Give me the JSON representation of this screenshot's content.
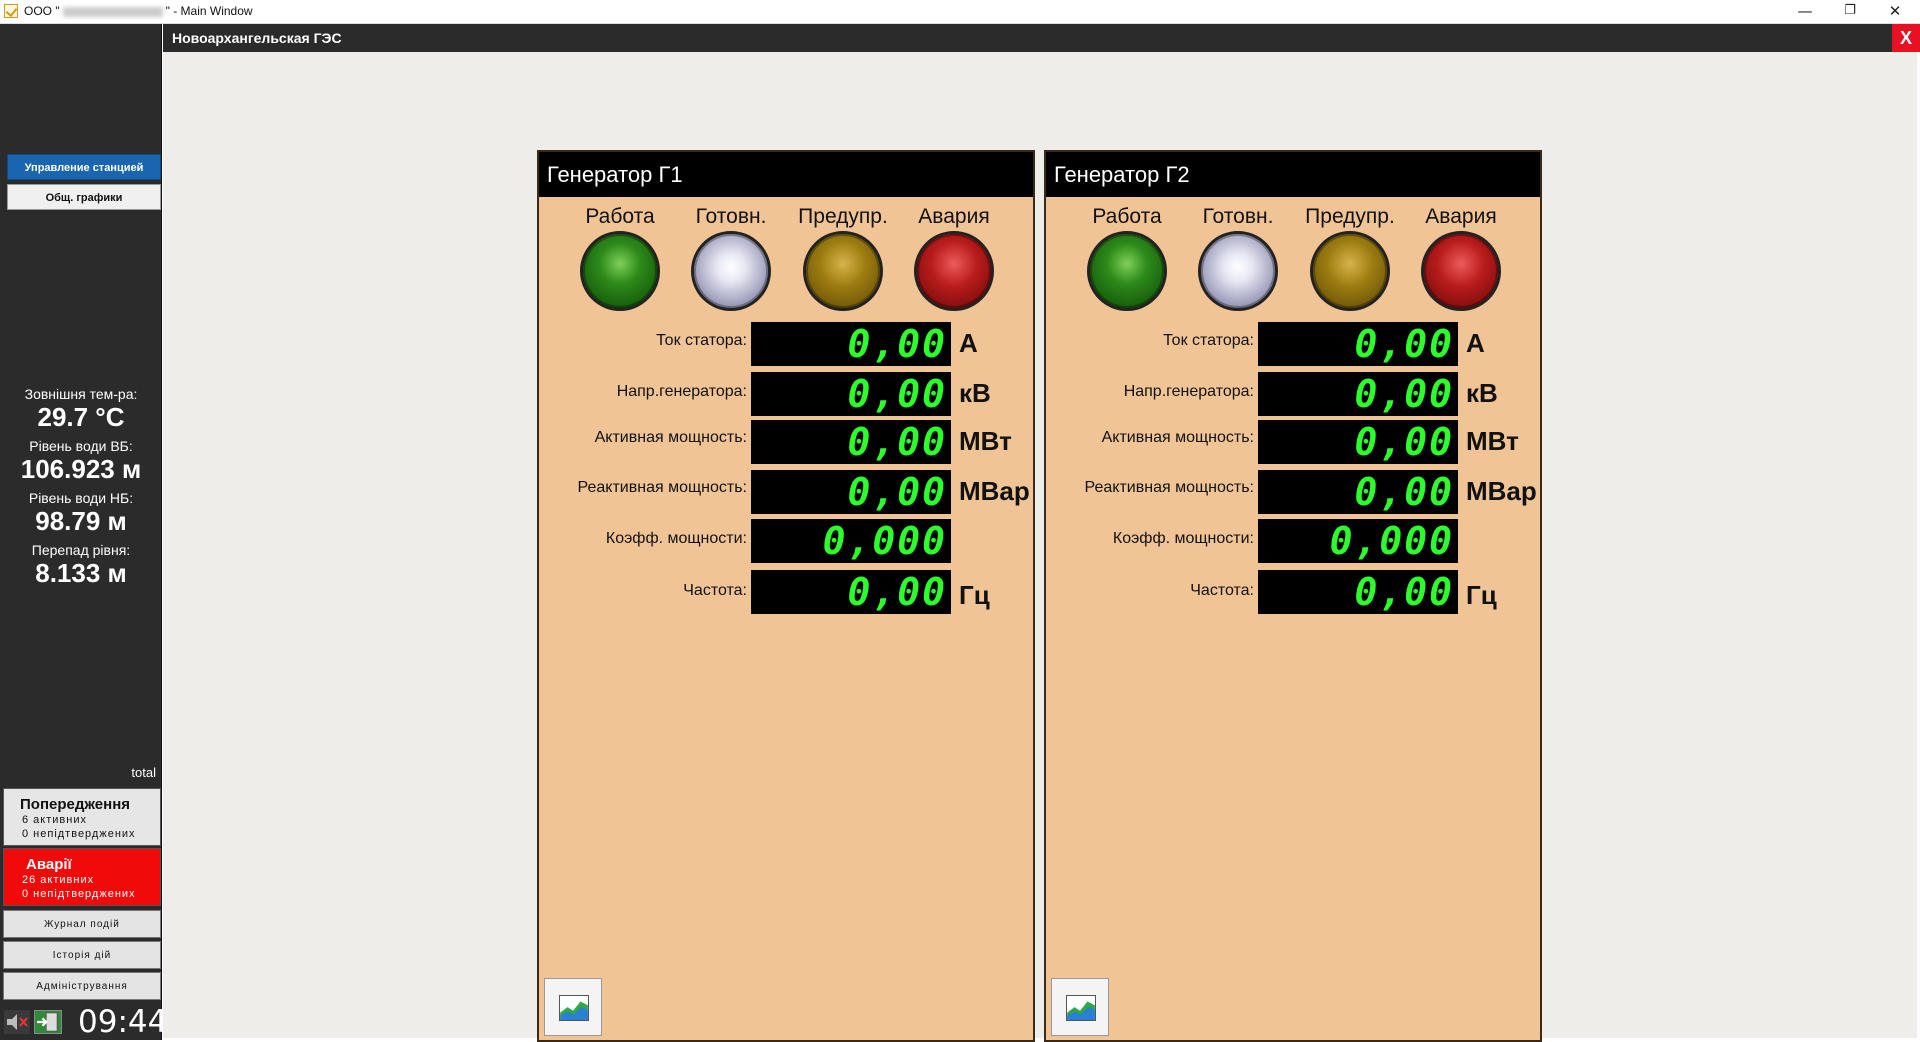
{
  "window": {
    "title_prefix": "ООО \"",
    "title_suffix": "\" - Main Window",
    "min_glyph": "—",
    "restore_glyph": "❐",
    "close_glyph": "✕"
  },
  "sidebar": {
    "nav": [
      {
        "label": "Управление станцией"
      },
      {
        "label": "Общ. графики"
      }
    ],
    "metrics": [
      {
        "label": "Зовнішня тем-ра:",
        "value": "29.7 °C"
      },
      {
        "label": "Рівень води ВБ:",
        "value": "106.923 м"
      },
      {
        "label": "Рівень води НБ:",
        "value": "98.79 м"
      },
      {
        "label": "Перепад рівня:",
        "value": "8.133 м"
      }
    ],
    "total_label": "total",
    "warnings": {
      "title": "Попередження",
      "active": "6 активних",
      "unconfirmed": "0 непідтверджених"
    },
    "alarms": {
      "title": "Аварії",
      "active": "26 активних",
      "unconfirmed": "0 непідтверджених",
      "color": "#f00a0a"
    },
    "buttons": [
      {
        "label": "Журнал подій"
      },
      {
        "label": "Історія дій"
      },
      {
        "label": "Адміністрування"
      }
    ],
    "clock": "09:44"
  },
  "main": {
    "station_title": "Новоархангельская ГЭС",
    "close_label": "X"
  },
  "generators": [
    {
      "title": "Генератор Г1",
      "lamps": [
        {
          "label": "Работа",
          "color": "green"
        },
        {
          "label": "Готовн.",
          "color": "white"
        },
        {
          "label": "Предупр.",
          "color": "yellow"
        },
        {
          "label": "Авария",
          "color": "red"
        }
      ],
      "params": [
        {
          "label": "Ток статора:",
          "value": "0,00",
          "unit": "А"
        },
        {
          "label": "Напр.генератора:",
          "value": "0,00",
          "unit": "кВ"
        },
        {
          "label": "Активная мощность:",
          "value": "0,00",
          "unit": "МВт"
        },
        {
          "label": "Реактивная мощность:",
          "value": "0,00",
          "unit": "МВар"
        },
        {
          "label": "Коэфф. мощности:",
          "value": "0,000",
          "unit": ""
        },
        {
          "label": "Частота:",
          "value": "0,00",
          "unit": "Гц"
        }
      ]
    },
    {
      "title": "Генератор Г2",
      "lamps": [
        {
          "label": "Работа",
          "color": "green"
        },
        {
          "label": "Готовн.",
          "color": "white"
        },
        {
          "label": "Предупр.",
          "color": "yellow"
        },
        {
          "label": "Авария",
          "color": "red"
        }
      ],
      "params": [
        {
          "label": "Ток статора:",
          "value": "0,00",
          "unit": "А"
        },
        {
          "label": "Напр.генератора:",
          "value": "0,00",
          "unit": "кВ"
        },
        {
          "label": "Активная мощность:",
          "value": "0,00",
          "unit": "МВт"
        },
        {
          "label": "Реактивная мощность:",
          "value": "0,00",
          "unit": "МВар"
        },
        {
          "label": "Коэфф. мощности:",
          "value": "0,000",
          "unit": ""
        },
        {
          "label": "Частота:",
          "value": "0,00",
          "unit": "Гц"
        }
      ]
    }
  ]
}
